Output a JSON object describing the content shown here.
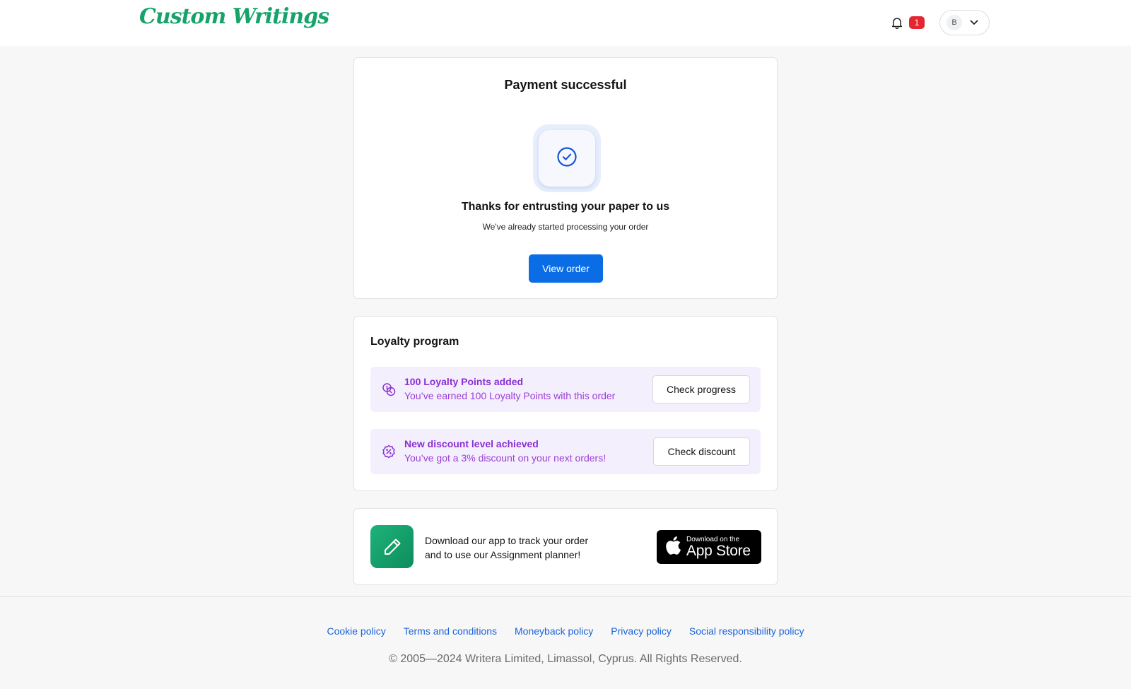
{
  "header": {
    "logo_text": "Custom Writings",
    "notification_count": "1",
    "avatar_initial": "B"
  },
  "payment": {
    "title": "Payment successful",
    "thanks": "Thanks for entrusting your paper to us",
    "subtitle": "We've already started processing your order",
    "view_order_label": "View order"
  },
  "loyalty": {
    "title": "Loyalty program",
    "items": [
      {
        "icon": "coins-icon",
        "heading": "100 Loyalty Points added",
        "description": "You’ve earned 100 Loyalty Points with this order",
        "button": "Check progress"
      },
      {
        "icon": "discount-badge-icon",
        "heading": "New discount level achieved",
        "description": "You’ve got a 3% discount on your next orders!",
        "button": "Check discount"
      }
    ]
  },
  "app_promo": {
    "line1": "Download our app to track your order",
    "line2": "and to use our Assignment planner!",
    "store_small": "Download on the",
    "store_big": "App Store"
  },
  "footer": {
    "links": [
      "Cookie policy",
      "Terms and conditions",
      "Moneyback policy",
      "Privacy policy",
      "Social responsibility policy"
    ],
    "copyright": "© 2005—2024 Writera Limited, Limassol, Cyprus. All Rights Reserved."
  },
  "colors": {
    "brand_green": "#16a36a",
    "primary_blue": "#0a6de6",
    "loyalty_purple": "#8a2fd1",
    "badge_red": "#e3262f"
  }
}
